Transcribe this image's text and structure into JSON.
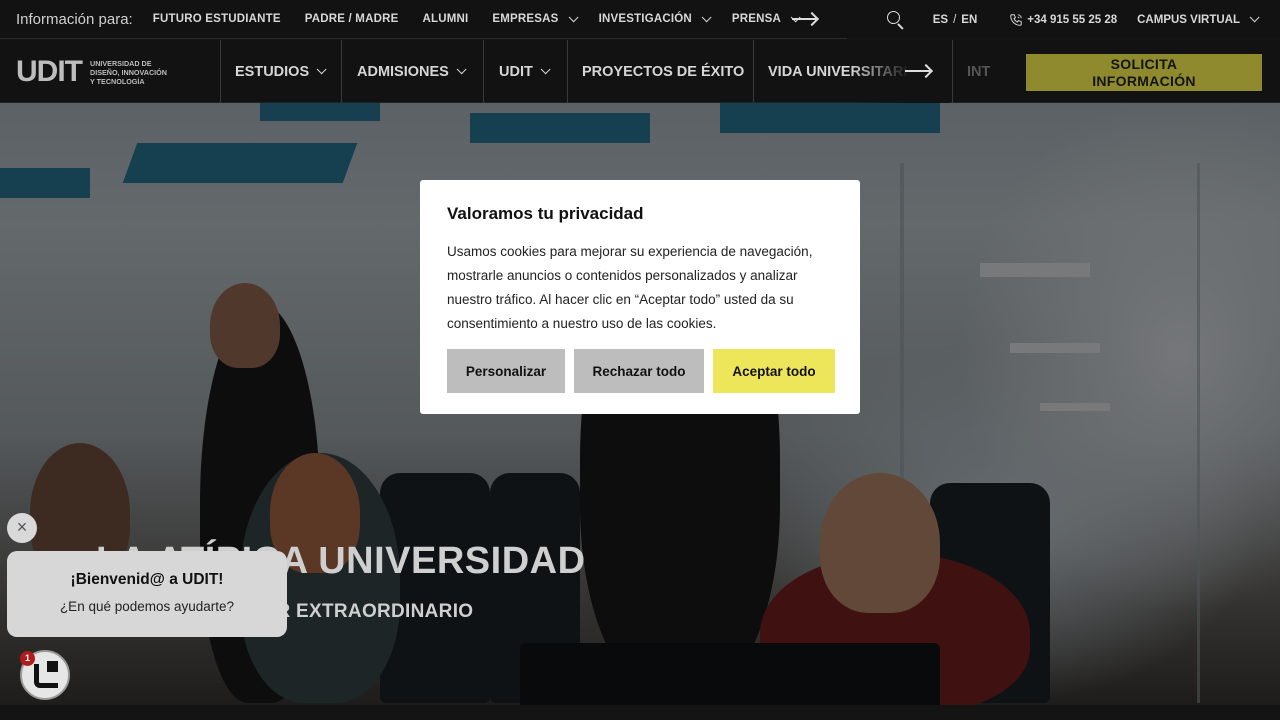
{
  "topbar": {
    "info_label": "Información para:",
    "links": [
      {
        "label": "FUTURO ESTUDIANTE",
        "dropdown": false
      },
      {
        "label": "PADRE / MADRE",
        "dropdown": false
      },
      {
        "label": "ALUMNI",
        "dropdown": false
      },
      {
        "label": "EMPRESAS",
        "dropdown": true
      },
      {
        "label": "INVESTIGACIÓN",
        "dropdown": true
      },
      {
        "label": "PRENSA",
        "dropdown": true
      }
    ],
    "scroll_icon": "arrow-right-icon",
    "search_icon": "search-icon",
    "lang_es": "ES",
    "lang_sep": "/",
    "lang_en": "EN",
    "phone": "+34 915 55 25 28",
    "phone_icon": "phone-icon",
    "campus": "CAMPUS VIRTUAL"
  },
  "mainnav": {
    "logo_mark": "UDIT",
    "logo_text": [
      "UNIVERSIDAD DE",
      "DISEÑO, INNOVACIÓN",
      "Y TECNOLOGÍA"
    ],
    "items": [
      {
        "label": "ESTUDIOS",
        "dropdown": true
      },
      {
        "label": "ADMISIONES",
        "dropdown": true
      },
      {
        "label": "UDIT",
        "dropdown": true
      },
      {
        "label": "PROYECTOS DE ÉXITO",
        "dropdown": false
      },
      {
        "label": "VIDA UNIVERSITARIA",
        "dropdown": false
      },
      {
        "label": "INT",
        "dropdown": false
      }
    ],
    "cta": "SOLICITA INFORMACIÓN"
  },
  "hero": {
    "title": "LA ATÍPICA UNIVERSIDAD",
    "subtitle": "LO NORMAL ES SER EXTRAORDINARIO"
  },
  "cookie": {
    "title": "Valoramos tu privacidad",
    "body": "Usamos cookies para mejorar su experiencia de navegación, mostrarle anuncios o contenidos personalizados y analizar nuestro tráfico. Al hacer clic en “Aceptar todo” usted da su consentimiento a nuestro uso de las cookies.",
    "btn_customize": "Personalizar",
    "btn_reject": "Rechazar todo",
    "btn_accept": "Aceptar todo"
  },
  "chat": {
    "close": "×",
    "greeting": "¡Bienvenid@ a UDIT!",
    "question": "¿En qué podemos ayudarte?",
    "badge": "1"
  },
  "colors": {
    "accent_yellow": "#eee65a",
    "cta_bg": "#8e8a2d",
    "dark_bg": "#121212"
  }
}
